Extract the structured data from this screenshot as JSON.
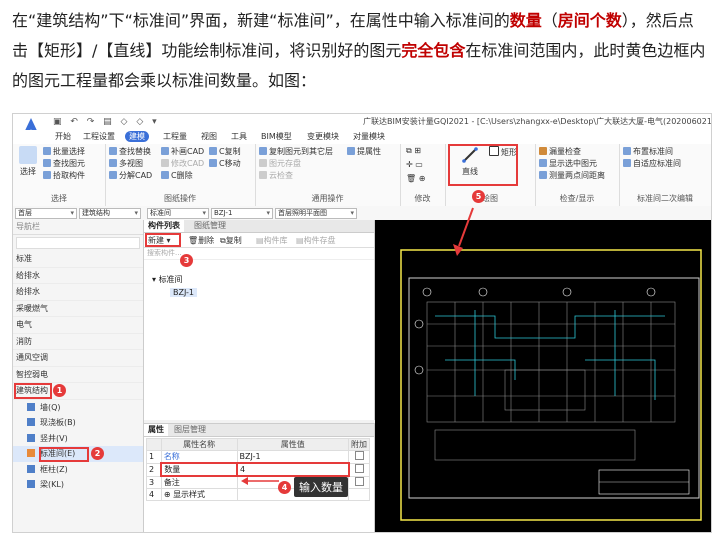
{
  "article": {
    "p1": "在“建筑结构”下“标准间”界面，新建“标准间”，在属性中输入标准间的",
    "bold1": "数量",
    "p2": "（",
    "bold2": "房间个数",
    "p3": "），然后点击【矩形】/【直线】功能绘制标准间，将识别好的图元",
    "bold3": "完全包含",
    "p4": "在标准间范围内，此时黄色边框内的图元工程量都会乘以标准间数量。如图："
  },
  "app": {
    "title": "广联达BIM安装计量GQI2021 - [C:\\Users\\zhangxx-e\\Desktop\\广大联达大厦-电气(20200602165040).",
    "menus": [
      "开始",
      "工程设置",
      "建模",
      "工程量",
      "视图",
      "工具",
      "BIM模型",
      "变更模块",
      "对量模块"
    ],
    "active_menu": "建模"
  },
  "ribbon": {
    "select_label": "选择",
    "select_group": [
      "批量选择",
      "查找图元",
      "拾取构件"
    ],
    "select_group_label": "选择",
    "draw_items": [
      "查找替换",
      "多视图",
      "分解CAD",
      "补画CAD",
      "修改CAD",
      "C复制",
      "C移动",
      "C删除"
    ],
    "draw_group_label": "图纸操作",
    "general_items": [
      "复制图元到其它层",
      "图元存盘",
      "云检查",
      "提属性"
    ],
    "general_group_label": "通用操作",
    "modify_group_label": "修改",
    "line_label": "直线",
    "rect_label": "矩形",
    "drawing_group_label": "绘图",
    "check_items": [
      "漏量检查",
      "显示选中图元",
      "测量两点间距离"
    ],
    "check_group_label": "检查/显示",
    "std_items": [
      "布置标准间",
      "自适应标准间"
    ],
    "std_group_label": "标准间二次编辑"
  },
  "toolbar2": {
    "floor": "首层",
    "category": "建筑结构",
    "type": "标准间",
    "item": "BZJ-1",
    "plan": "首层照明平面图"
  },
  "leftnav": {
    "header": "导航栏",
    "items": [
      "给排水",
      "采暖燃气",
      "电气",
      "消防",
      "通风空调",
      "智控弱电"
    ],
    "top_items": [
      "标准",
      "给排水"
    ],
    "group": "建筑结构",
    "subs": [
      "墙(Q)",
      "现浇板(B)",
      "竖井(V)",
      "标准间(E)",
      "框柱(Z)",
      "梁(KL)"
    ]
  },
  "complist": {
    "tabs": [
      "构件列表",
      "图纸管理"
    ],
    "new_label": "新建",
    "delete_label": "删除",
    "copy_label": "复制",
    "dim_tools": [
      "构件库",
      "构件存盘"
    ],
    "search_placeholder": "搜索构件...",
    "tree_root": "标准间",
    "tree_child": "BZJ-1"
  },
  "props": {
    "tabs": [
      "属性",
      "图层管理"
    ],
    "headers": [
      "属性名称",
      "属性值",
      "附加"
    ],
    "rows": [
      {
        "n": "1",
        "name": "名称",
        "value": "BZJ-1"
      },
      {
        "n": "2",
        "name": "数量",
        "value": "4"
      },
      {
        "n": "3",
        "name": "备注",
        "value": ""
      },
      {
        "n": "4",
        "name": "显示样式",
        "value": ""
      }
    ]
  },
  "annotations": {
    "input_qty": "输入数量",
    "badges": [
      "1",
      "2",
      "3",
      "4",
      "5"
    ]
  },
  "colors": {
    "highlight_red": "#e53a3a",
    "yellow_frame": "#f5e84a",
    "accent_blue": "#3a6fd8",
    "text_red": "#c00000"
  }
}
